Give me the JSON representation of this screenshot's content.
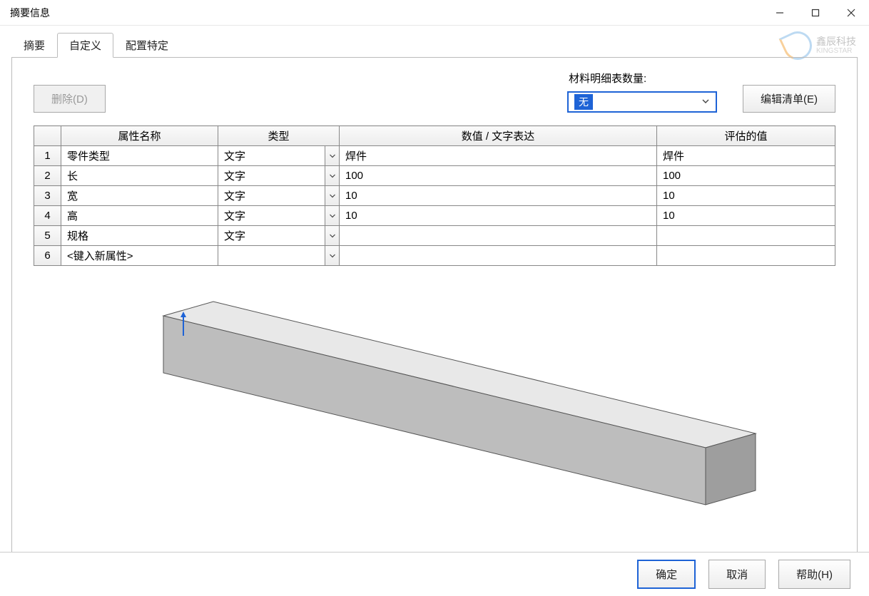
{
  "window": {
    "title": "摘要信息"
  },
  "tabs": [
    {
      "label": "摘要"
    },
    {
      "label": "自定义"
    },
    {
      "label": "配置特定"
    }
  ],
  "toolbar": {
    "delete_label": "删除(D)",
    "bom_label": "材料明细表数量:",
    "bom_value": "无",
    "edit_list_label": "编辑清单(E)"
  },
  "table": {
    "headers": {
      "name": "属性名称",
      "type": "类型",
      "value": "数值 / 文字表达",
      "eval": "评估的值"
    },
    "rows": [
      {
        "idx": "1",
        "name": "零件类型",
        "type": "文字",
        "value": "焊件",
        "eval": "焊件"
      },
      {
        "idx": "2",
        "name": "长",
        "type": "文字",
        "value": "100",
        "eval": "100"
      },
      {
        "idx": "3",
        "name": "宽",
        "type": "文字",
        "value": "10",
        "eval": "10"
      },
      {
        "idx": "4",
        "name": "高",
        "type": "文字",
        "value": "10",
        "eval": "10"
      },
      {
        "idx": "5",
        "name": "规格",
        "type": "文字",
        "value": "",
        "eval": ""
      },
      {
        "idx": "6",
        "name": "<键入新属性>",
        "type": "",
        "value": "",
        "eval": ""
      }
    ]
  },
  "footer": {
    "ok": "确定",
    "cancel": "取消",
    "help": "帮助(H)"
  },
  "watermark": {
    "brand": "鑫辰科技",
    "sub": "KINGSTAR"
  }
}
